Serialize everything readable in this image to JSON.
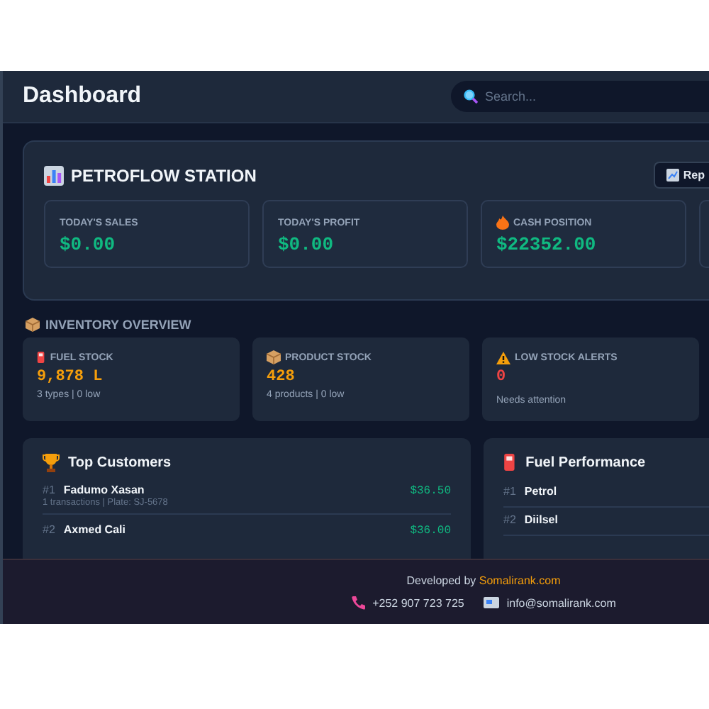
{
  "header": {
    "title": "Dashboard",
    "search": {
      "placeholder": "Search..."
    }
  },
  "station": {
    "title": "PETROFLOW STATION",
    "report_button": "Rep",
    "stats": [
      {
        "label": "TODAY'S SALES",
        "value": "$0.00"
      },
      {
        "label": "TODAY'S PROFIT",
        "value": "$0.00"
      },
      {
        "label": "CASH POSITION",
        "value": "$22352.00"
      }
    ]
  },
  "inventory": {
    "title": "INVENTORY OVERVIEW",
    "cards": [
      {
        "label": "FUEL STOCK",
        "value": "9,878 L",
        "detail": "3 types | 0 low",
        "color": "#f59e0b"
      },
      {
        "label": "PRODUCT STOCK",
        "value": "428",
        "detail": "4 products | 0 low",
        "color": "#f59e0b"
      },
      {
        "label": "LOW STOCK ALERTS",
        "value": "0",
        "detail": "Needs attention",
        "color": "#ef4444"
      }
    ]
  },
  "top_customers": {
    "title": "Top Customers",
    "rows": [
      {
        "rank": "#1",
        "name": "Fadumo Xasan",
        "amount": "$36.50",
        "detail": "1 transactions | Plate: SJ-5678"
      },
      {
        "rank": "#2",
        "name": "Axmed Cali",
        "amount": "$36.00"
      }
    ]
  },
  "fuel_performance": {
    "title": "Fuel Performance",
    "rows": [
      {
        "rank": "#1",
        "name": "Petrol"
      },
      {
        "rank": "#2",
        "name": "Diilsel"
      }
    ]
  },
  "footer": {
    "credit": "Developed by",
    "site": "Somalirank.com",
    "phone": "+252 907 723 725",
    "email": "info@somalirank.com"
  }
}
